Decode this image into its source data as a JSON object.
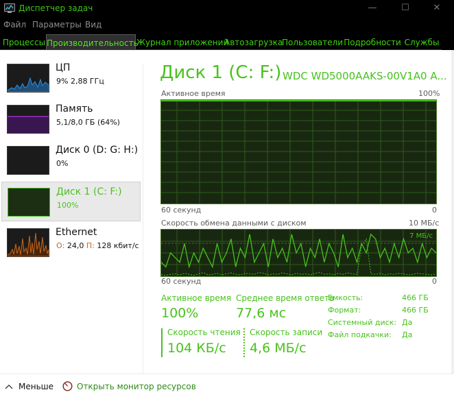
{
  "window": {
    "title": "Диспетчер задач",
    "minimize": "—",
    "maximize": "☐",
    "close": "✕"
  },
  "menu": [
    "Файл",
    "Параметры",
    "Вид"
  ],
  "tabs": [
    "Процессы",
    "Производительность",
    "Журнал приложений",
    "Автозагрузка",
    "Пользователи",
    "Подробности",
    "Службы"
  ],
  "sidebar": [
    {
      "title": "ЦП",
      "sub": "9%  2,88 ГГц",
      "color": "#2f8fe0"
    },
    {
      "title": "Память",
      "sub": "5,1/8,0 ГБ (64%)",
      "color": "#9b2fc8"
    },
    {
      "title": "Диск 0 (D: G: H:)",
      "sub": "0%",
      "color": "#4c9a1f"
    },
    {
      "title": "Диск 1 (C: F:)",
      "sub": "100%",
      "color": "#48c21d"
    },
    {
      "title": "Ethernet",
      "sub_o": "О:",
      "sub_o_val": "24,0",
      "sub_p": "П:",
      "sub_p_val": "128 кбит/с",
      "color": "#c9671b"
    }
  ],
  "main": {
    "title": "Диск 1 (C: F:)",
    "model": "WDC WD5000AAKS-00V1A0 A...",
    "graph1": {
      "label": "Активное время",
      "max": "100%",
      "time": "60 секунд",
      "min": "0"
    },
    "graph2": {
      "label": "Скорость обмена данными с диском",
      "max": "10 МБ/с",
      "inner": "7 МБ/с",
      "time": "60 секунд",
      "min": "0"
    },
    "stats": {
      "active_label": "Активное время",
      "active_value": "100%",
      "resp_label": "Среднее время ответа",
      "resp_value": "77,6 мс",
      "read_label": "Скорость чтения",
      "read_value": "104 КБ/с",
      "write_label": "Скорость записи",
      "write_value": "4,6 МБ/с"
    },
    "props": [
      {
        "k": "Емкость:",
        "v": "466 ГБ"
      },
      {
        "k": "Формат:",
        "v": "466 ГБ"
      },
      {
        "k": "Системный диск:",
        "v": "Да"
      },
      {
        "k": "Файл подкачки:",
        "v": "Да"
      }
    ]
  },
  "footer": {
    "less": "Меньше",
    "monitor": "Открыть монитор ресурсов"
  },
  "chart_data": {
    "type": "line",
    "title": "Скорость обмена данными с диском",
    "ylim": [
      0,
      10
    ],
    "series": [
      {
        "values": [
          3,
          2,
          5,
          4,
          3,
          7,
          2,
          5,
          3,
          6,
          4,
          2,
          7,
          3,
          5,
          8,
          2,
          6,
          4,
          9,
          3,
          5,
          7,
          2,
          8,
          4,
          6,
          3,
          9,
          5,
          7,
          2,
          6,
          4,
          8,
          3,
          7,
          5,
          2,
          9,
          4,
          6,
          3,
          7,
          5,
          9,
          8,
          4,
          6,
          3,
          7,
          4,
          8,
          5,
          6,
          3,
          7,
          4,
          6,
          5
        ]
      },
      {
        "values": [
          0.3,
          0.2,
          0.4,
          0.5,
          0.3,
          0.6,
          0.4,
          0.2,
          0.5,
          0.8,
          0.3,
          0.4,
          0.6,
          0.3,
          0.5,
          0.7,
          0.4,
          0.3,
          0.6,
          0.5,
          0.4,
          0.8,
          0.6,
          0.3,
          0.5,
          0.4,
          0.7,
          0.5,
          0.3,
          0.6,
          0.4,
          0.5,
          0.3,
          0.6,
          0.8,
          0.4,
          0.5,
          0.3,
          0.6,
          0.4,
          0.7,
          0.5,
          0.4,
          6.5,
          8,
          0.5,
          0.4,
          0.6,
          0.3,
          0.5,
          0.4,
          0.6,
          0.5,
          0.3,
          0.4,
          0.6,
          0.5,
          0.4,
          0.3,
          0.5
        ]
      }
    ]
  }
}
